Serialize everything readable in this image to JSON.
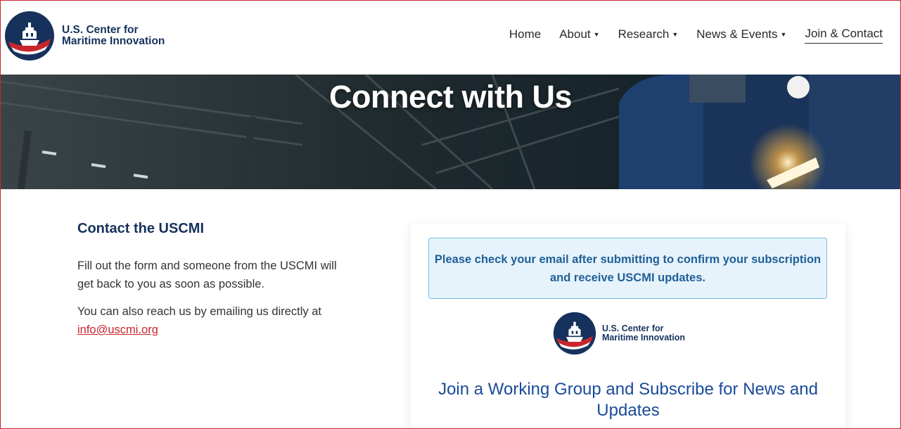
{
  "header": {
    "logo": {
      "line1": "U.S. Center for",
      "line2": "Maritime Innovation"
    },
    "nav": [
      {
        "label": "Home"
      },
      {
        "label": "About"
      },
      {
        "label": "Research"
      },
      {
        "label": "News & Events"
      },
      {
        "label": "Join & Contact"
      }
    ]
  },
  "hero": {
    "title": "Connect with Us"
  },
  "contact": {
    "heading": "Contact the USCMI",
    "paragraph1": "Fill out the form and someone from the USCMI will get back to you as soon as possible.",
    "paragraph2_prefix": "You can also reach us by emailing us directly at",
    "email": "info@uscmi.org"
  },
  "card": {
    "notice": "Please check your email after submitting to confirm your subscription and receive USCMI updates.",
    "logo": {
      "line1": "U.S. Center for",
      "line2": "Maritime Innovation"
    },
    "title": "Join a Working Group and Subscribe for News and Updates"
  },
  "colors": {
    "navy": "#16325c",
    "red": "#c9262c",
    "accent_blue": "#1a4a9a",
    "notice_bg": "#e6f3fb"
  }
}
